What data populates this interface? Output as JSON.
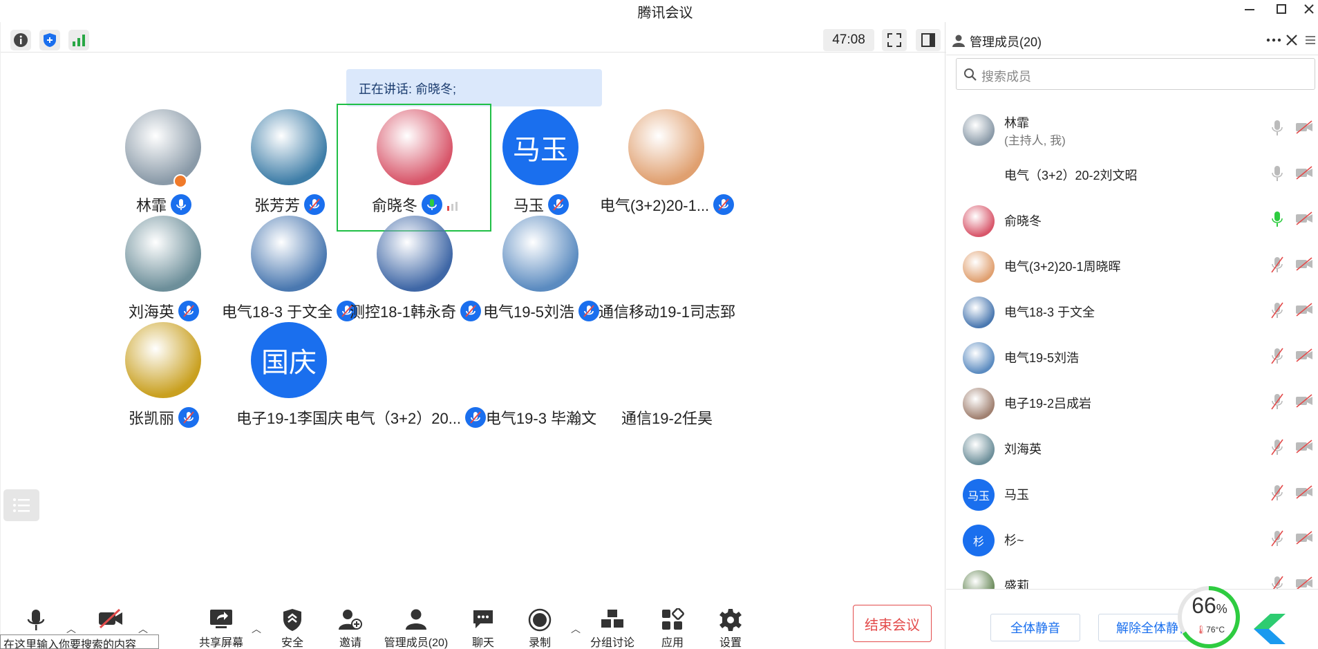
{
  "window": {
    "title": "腾讯会议"
  },
  "topbar": {
    "timer": "47:08"
  },
  "speaking": {
    "text": "正在讲话: 俞晓冬;"
  },
  "tiles": [
    {
      "name": "林霏",
      "avatar_color": "#8a9aa8",
      "host": true
    },
    {
      "name": "张芳芳",
      "avatar_color": "#3f7ea8"
    },
    {
      "name": "俞晓冬",
      "avatar_color": "#d8566a",
      "active": true
    },
    {
      "name": "马玉",
      "avatar_text": "马玉"
    },
    {
      "name": "电气(3+2)20-1...",
      "avatar_color": "#e0a070"
    },
    {
      "name": "刘海英",
      "avatar_color": "#6d8f9a"
    },
    {
      "name": "电气18-3 于文全",
      "avatar_color": "#4a78b0"
    },
    {
      "name": "测控18-1韩永奇",
      "avatar_color": "#3f67a6"
    },
    {
      "name": "电气19-5刘浩",
      "avatar_color": "#5b8bc0"
    },
    {
      "name": "通信移动19-1司志郅",
      "avatar_color": "#fff"
    },
    {
      "name": "张凯丽",
      "avatar_color": "#c9a020"
    },
    {
      "name": "电子19-1李国庆",
      "avatar_text": "国庆"
    },
    {
      "name": "电气（3+2）20...",
      "avatar_color": "#fff"
    },
    {
      "name": "电气19-3 毕瀚文",
      "avatar_color": "#fff"
    },
    {
      "name": "通信19-2任昊",
      "avatar_color": "#fff"
    }
  ],
  "toolbar": {
    "share": "共享屏幕",
    "security": "安全",
    "invite": "邀请",
    "members": "管理成员(20)",
    "chat": "聊天",
    "record": "录制",
    "breakout": "分组讨论",
    "apps": "应用",
    "settings": "设置",
    "end": "结束会议"
  },
  "taskbar_search": "在这里输入你要搜索的内容",
  "panel": {
    "title": "管理成员(20)",
    "search_placeholder": "搜索成员",
    "members": [
      {
        "name": "林霏",
        "sub": "(主持人, 我)",
        "avatar_color": "#8a9aa8"
      },
      {
        "name": "电气（3+2）20-2刘文昭",
        "avatar_color": "#fff"
      },
      {
        "name": "俞晓冬",
        "avatar_color": "#d8566a",
        "speaking": true
      },
      {
        "name": "电气(3+2)20-1周晓晖",
        "avatar_color": "#e0a070",
        "muted": true
      },
      {
        "name": "电气18-3 于文全",
        "avatar_color": "#4a78b0",
        "muted": true
      },
      {
        "name": "电气19-5刘浩",
        "avatar_color": "#5b8bc0",
        "muted": true
      },
      {
        "name": "电子19-2吕成岩",
        "avatar_color": "#a08070",
        "muted": true
      },
      {
        "name": "刘海英",
        "avatar_color": "#6d8f9a",
        "muted": true
      },
      {
        "name": "马玉",
        "avatar_text": "马玉",
        "muted": true
      },
      {
        "name": "杉~",
        "avatar_text": "杉",
        "muted": true
      },
      {
        "name": "盛莉",
        "avatar_color": "#6a8a5a",
        "muted": true
      }
    ],
    "mute_all": "全体静音",
    "unmute_all": "解除全体静音"
  },
  "gauge": {
    "percent": "66",
    "percent_sign": "%",
    "temp": "76°C"
  },
  "colors": {
    "accent": "#1a6fee",
    "active_border": "#1fbf45",
    "end_red": "#e34b4b"
  }
}
